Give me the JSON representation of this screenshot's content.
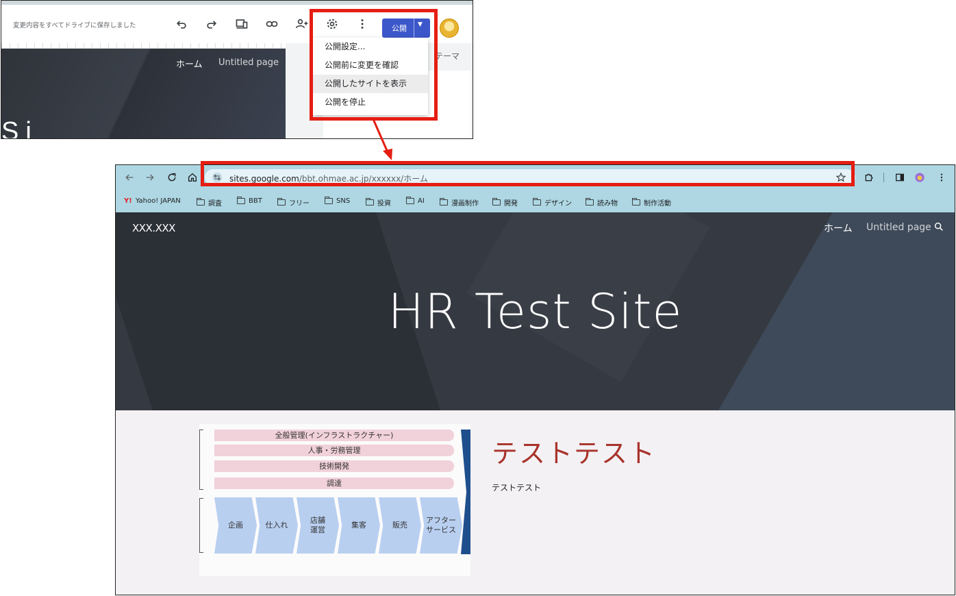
{
  "editor": {
    "save_status": "変更内容をすべてドライブに保存しました",
    "publish_label": "公開",
    "nav_home": "ホーム",
    "nav_untitled": "Untitled page",
    "panel_tab": "テーマ",
    "hero_fragment": "Si",
    "menu": {
      "items": [
        {
          "label": "公開設定..."
        },
        {
          "label": "公開前に変更を確認"
        },
        {
          "label": "公開したサイトを表示"
        },
        {
          "label": "公開を停止"
        }
      ]
    }
  },
  "browser": {
    "url_host": "sites.google.com",
    "url_path": "/bbt.ohmae.ac.jp/xxxxxx/ホーム",
    "bookmarks": [
      {
        "label": "Yahoo! JAPAN",
        "icon": "yahoo-icon"
      },
      {
        "label": "調査",
        "icon": "folder-icon"
      },
      {
        "label": "BBT",
        "icon": "folder-icon"
      },
      {
        "label": "フリー",
        "icon": "folder-icon"
      },
      {
        "label": "SNS",
        "icon": "folder-icon"
      },
      {
        "label": "投資",
        "icon": "folder-icon"
      },
      {
        "label": "AI",
        "icon": "folder-icon"
      },
      {
        "label": "漫画制作",
        "icon": "folder-icon"
      },
      {
        "label": "開発",
        "icon": "folder-icon"
      },
      {
        "label": "デザイン",
        "icon": "folder-icon"
      },
      {
        "label": "読み物",
        "icon": "folder-icon"
      },
      {
        "label": "制作活動",
        "icon": "folder-icon"
      }
    ]
  },
  "site": {
    "name": "XXX.XXX",
    "nav_home": "ホーム",
    "nav_untitled": "Untitled page",
    "title": "HR Test Site",
    "heading": "テストテスト",
    "body": "テストテスト",
    "diagram": {
      "bars": [
        "全般管理(インフラストラクチャー)",
        "人事・労務管理",
        "技術開発",
        "調達"
      ],
      "chevrons": [
        "企画",
        "仕入れ",
        "店舗\n運営",
        "集客",
        "販売",
        "アフター\nサービス"
      ]
    }
  },
  "colors": {
    "highlight": "#e51d12",
    "publish_button": "#3c57c9",
    "browser_chrome": "#aed7e3",
    "heading": "#a8322a"
  }
}
